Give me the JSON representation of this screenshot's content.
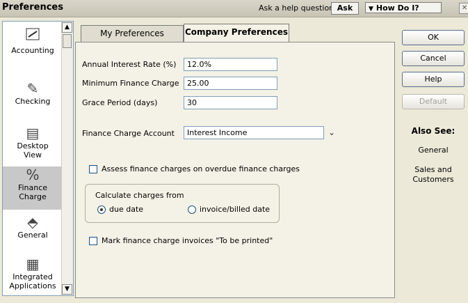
{
  "titlebar": {
    "title": "Preferences",
    "help_question": "Ask a help question",
    "ask_label": "Ask",
    "how_do_i": "How Do I?"
  },
  "sidebar": {
    "items": [
      {
        "label": "Accounting",
        "icon": "accounting-icon"
      },
      {
        "label": "Checking",
        "icon": "checking-icon"
      },
      {
        "label_line1": "Desktop",
        "label_line2": "View",
        "icon": "desktop-view-icon"
      },
      {
        "label_line1": "Finance",
        "label_line2": "Charge",
        "icon": "finance-charge-icon",
        "selected": true
      },
      {
        "label": "General",
        "icon": "general-icon"
      },
      {
        "label_line1": "Integrated",
        "label_line2": "Applications",
        "icon": "integrated-applications-icon"
      }
    ]
  },
  "tabs": {
    "my_preferences": "My Preferences",
    "company_preferences": "Company Preferences"
  },
  "form": {
    "interest_rate_label": "Annual Interest Rate (%)",
    "interest_rate_value": "12.0%",
    "min_charge_label": "Minimum Finance Charge",
    "min_charge_value": "25.00",
    "grace_label": "Grace Period (days)",
    "grace_value": "30",
    "account_label": "Finance Charge Account",
    "account_value": "Interest Income",
    "assess_label": "Assess finance charges on overdue finance charges",
    "calc_label": "Calculate charges from",
    "due_date_label": "due date",
    "invoice_date_label": "invoice/billed date",
    "mark_label": "Mark finance charge invoices \"To be printed\""
  },
  "buttons": {
    "ok": "OK",
    "cancel": "Cancel",
    "help": "Help",
    "default": "Default"
  },
  "also_see": {
    "heading": "Also See:",
    "general": "General",
    "sales_line1": "Sales and",
    "sales_line2": "Customers"
  }
}
